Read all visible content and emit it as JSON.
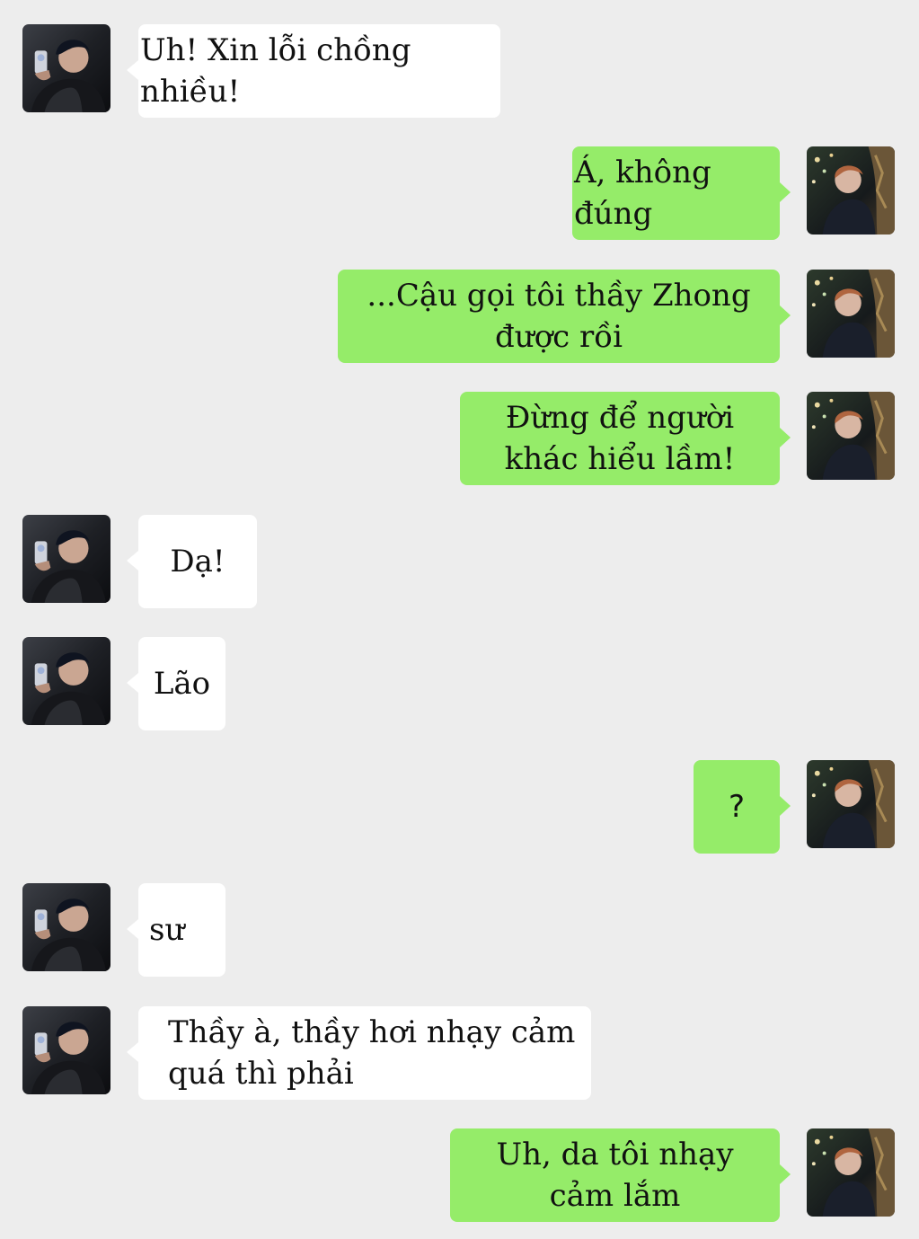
{
  "colors": {
    "background": "#ededed",
    "incoming_bubble": "#ffffff",
    "outgoing_bubble": "#95ec69"
  },
  "messages": [
    {
      "sender": "other",
      "text": "Uh! Xin lỗi chồng nhiều!"
    },
    {
      "sender": "me",
      "text": "Á, không đúng"
    },
    {
      "sender": "me",
      "text": "...Cậu gọi tôi thầy Zhong\nđược rồi"
    },
    {
      "sender": "me",
      "text": "Đừng để người\nkhác hiểu lầm!"
    },
    {
      "sender": "other",
      "text": "Dạ!"
    },
    {
      "sender": "other",
      "text": "Lão"
    },
    {
      "sender": "me",
      "text": "?"
    },
    {
      "sender": "other",
      "text": "sư"
    },
    {
      "sender": "other",
      "text": "Thầy à, thầy hơi nhạy cảm\nquá thì phải"
    },
    {
      "sender": "me",
      "text": "Uh, da tôi nhạy\ncảm lắm"
    }
  ]
}
